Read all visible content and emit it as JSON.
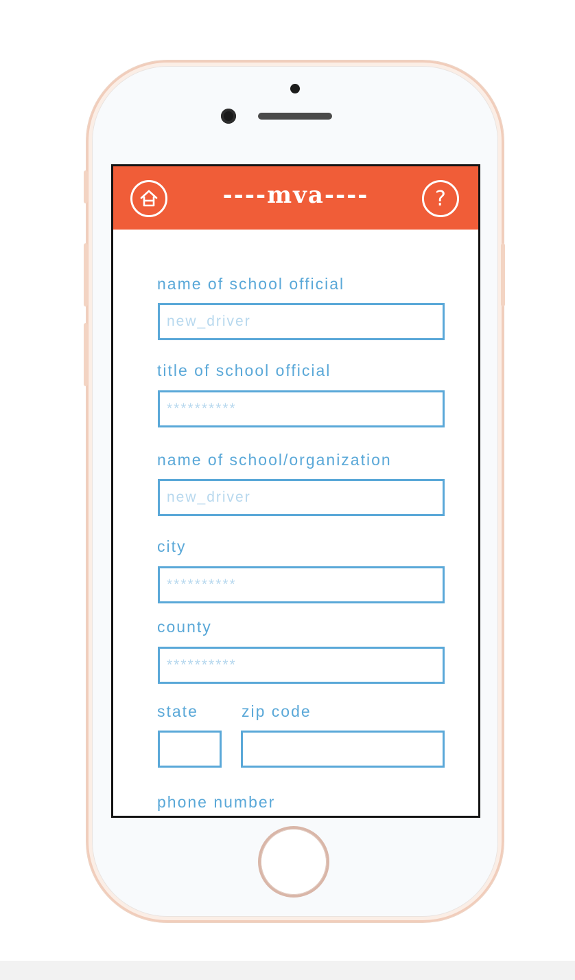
{
  "header": {
    "title": "----mva----",
    "home_icon": "home-icon",
    "help_symbol": "?"
  },
  "form": {
    "school_official_name": {
      "label": "name of school official",
      "placeholder": "new_driver"
    },
    "school_official_title": {
      "label": "title of school official",
      "placeholder": "**********"
    },
    "school_name": {
      "label": "name of school/organization",
      "placeholder": "new_driver"
    },
    "city": {
      "label": "city",
      "placeholder": "**********"
    },
    "county": {
      "label": "county",
      "placeholder": "**********"
    },
    "state": {
      "label": "state",
      "placeholder": ""
    },
    "zip": {
      "label": "zip code",
      "placeholder": ""
    },
    "phone": {
      "label": "phone number"
    }
  },
  "colors": {
    "header": "#f05d38",
    "accent": "#5aa8d8",
    "placeholder": "#b7d8ee",
    "phone_frame": "#f1cdbb"
  }
}
